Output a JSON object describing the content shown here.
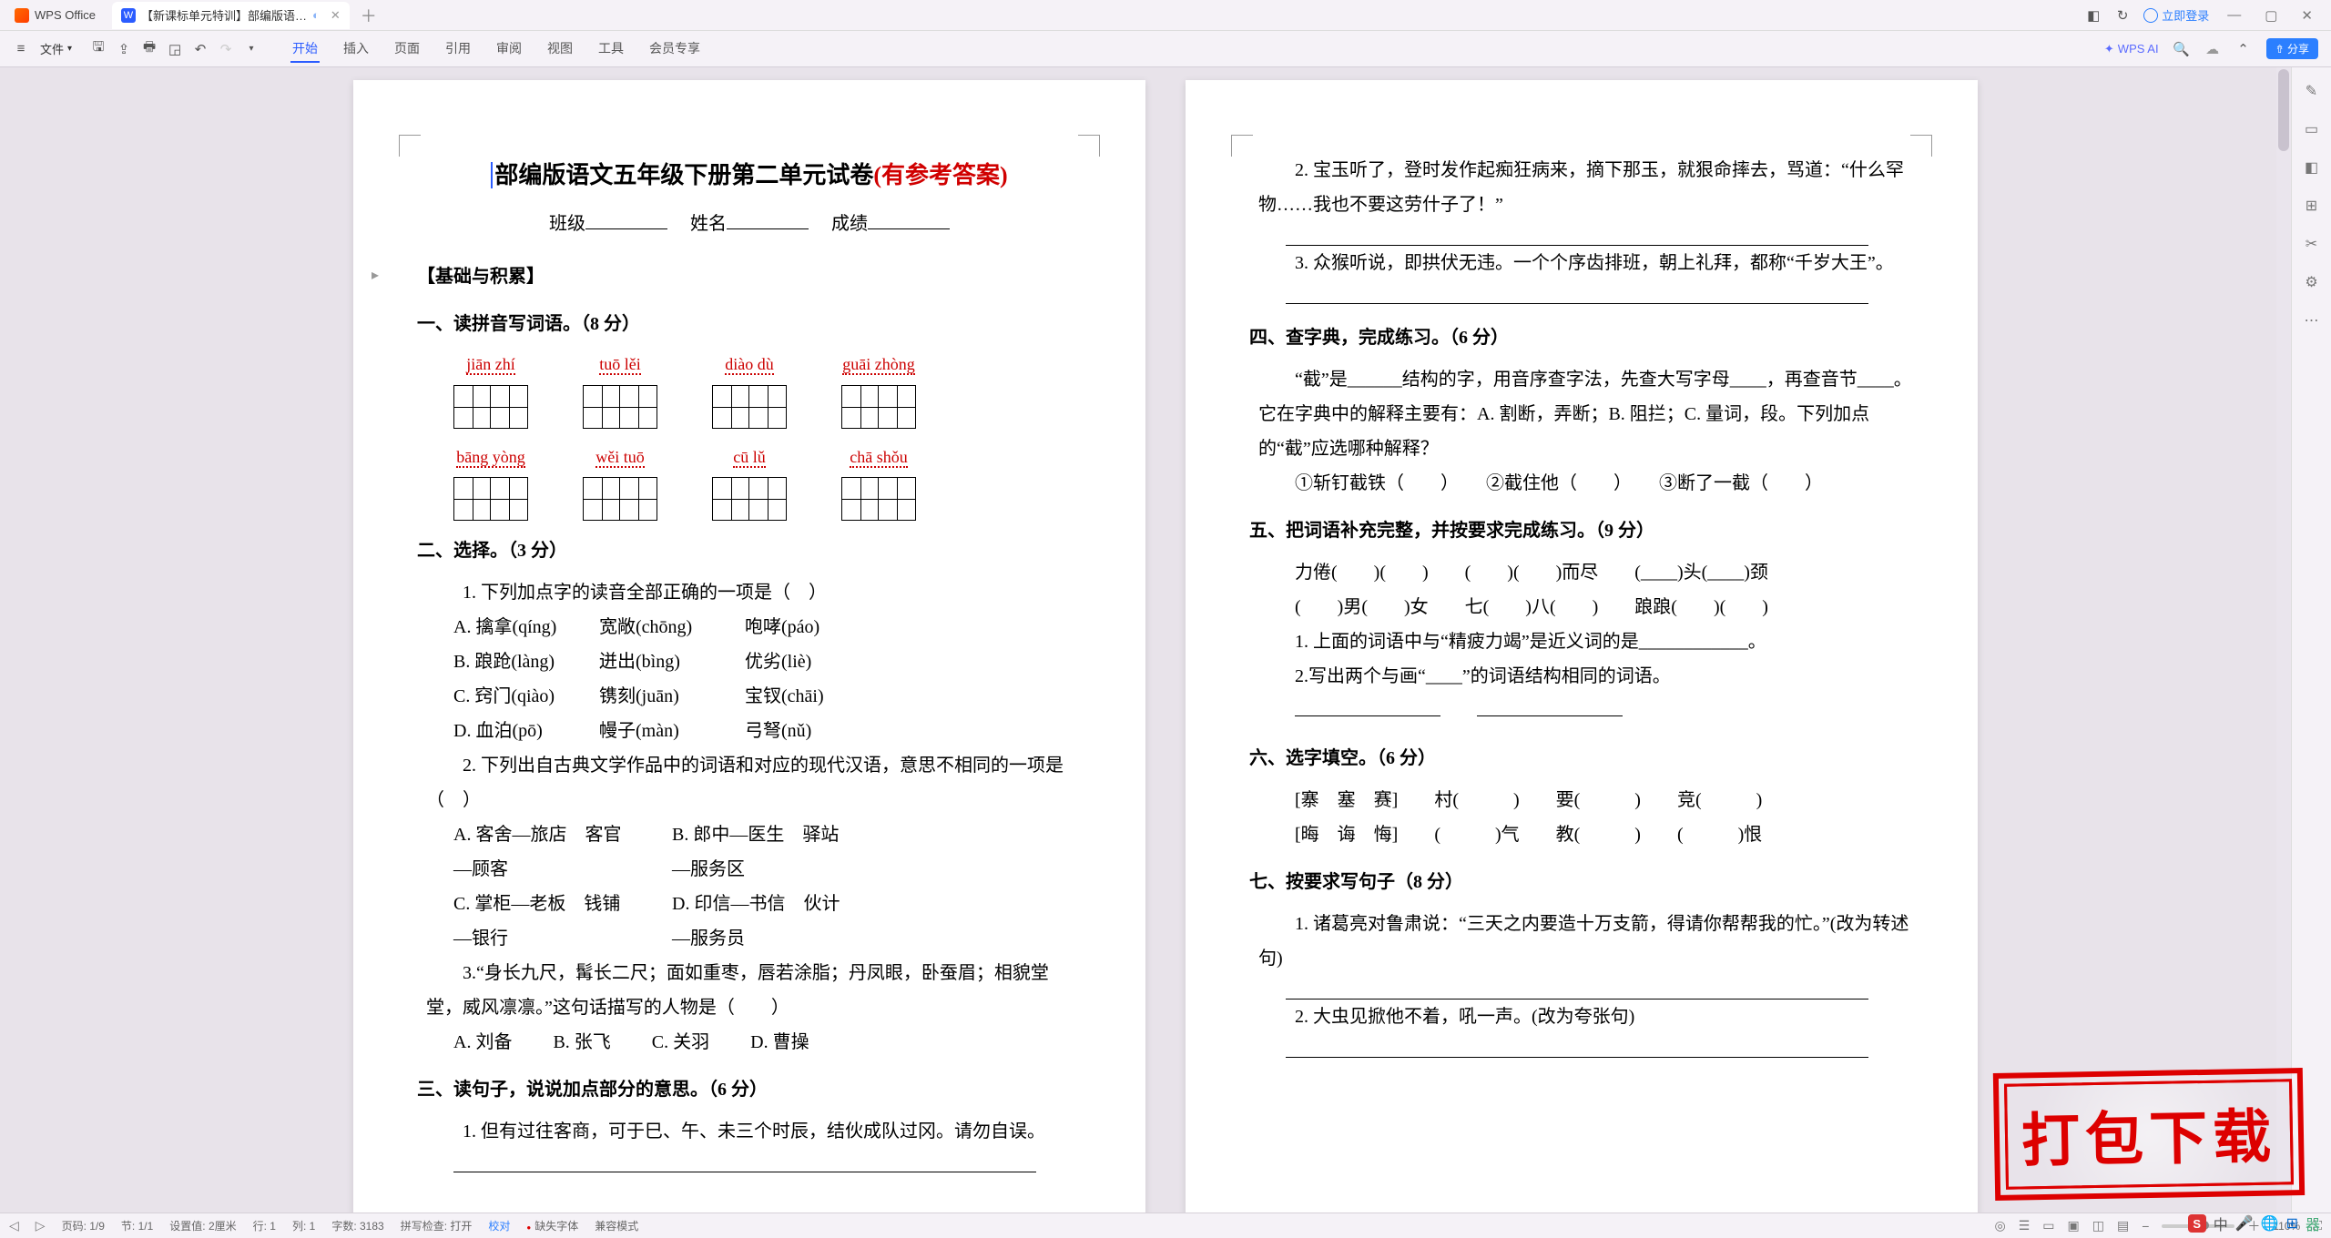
{
  "titlebar": {
    "app_name": "WPS Office",
    "doc_tab_label": "【新课标单元特训】部编版语…",
    "login_label": "立即登录"
  },
  "ribbon": {
    "file_menu": "文件",
    "tabs": [
      "开始",
      "插入",
      "页面",
      "引用",
      "审阅",
      "视图",
      "工具",
      "会员专享"
    ],
    "ai_label": "WPS AI",
    "share_label": "分享",
    "cloud_tip": "☁"
  },
  "page1": {
    "title_black": "部编版语文五年级下册第二单元试卷",
    "title_red": "(有参考答案)",
    "info_labels": [
      "班级",
      "姓名",
      "成绩"
    ],
    "section_basics": "【基础与积累】",
    "q1": "一、读拼音写词语。（8 分）",
    "pinyin_row1": [
      "jiān zhí",
      "tuō lěi",
      "diào dù",
      "guāi zhòng"
    ],
    "pinyin_row2": [
      "bāng yòng",
      "wěi tuō",
      "cū   lǔ",
      "chā shǒu"
    ],
    "q2": "二、选择。（3 分）",
    "q2_1": "1. 下列加点字的读音全部正确的一项是（　）",
    "q2_1_opts": [
      [
        "A. 擒拿(qíng)",
        "宽敞(chōng)",
        "咆哮(páo)"
      ],
      [
        "B. 踉跄(làng)",
        "迸出(bìng)",
        "优劣(liè)"
      ],
      [
        "C. 窍门(qiào)",
        "镌刻(juān)",
        "宝钗(chāi)"
      ],
      [
        "D. 血泊(pō)",
        "幔子(màn)",
        "弓弩(nǔ)"
      ]
    ],
    "q2_2": "2. 下列出自古典文学作品中的词语和对应的现代汉语，意思不相同的一项是（　）",
    "q2_2_opts": [
      [
        "A. 客舍—旅店　客官—顾客",
        "B. 郎中—医生　驿站—服务区"
      ],
      [
        "C. 掌柜—老板　钱铺—银行",
        "D. 印信—书信　伙计—服务员"
      ]
    ],
    "q2_3": "3.“身长九尺，髯长二尺；面如重枣，唇若涂脂；丹凤眼，卧蚕眉；相貌堂堂，威风凛凛。”这句话描写的人物是（　　）",
    "q2_3_opts": [
      "A. 刘备",
      "B. 张飞",
      "C. 关羽",
      "D. 曹操"
    ],
    "q3": "三、读句子，说说加点部分的意思。（6 分）",
    "q3_1": "1. 但有过往客商，可于巳、午、未三个时辰，结伙成队过冈。请勿自误。"
  },
  "page2": {
    "line1": "2. 宝玉听了，登时发作起痴狂病来，摘下那玉，就狠命摔去，骂道：“什么罕物……我也不要这劳什子了！”",
    "line2": "3. 众猴听说，即拱伏无违。一个个序齿排班，朝上礼拜，都称“千岁大王”。",
    "q4": "四、查字典，完成练习。（6 分）",
    "q4_text": "“截”是______结构的字，用音序查字法，先查大写字母____，再查音节____。它在字典中的解释主要有：A. 割断，弄断；B. 阻拦；C. 量词，段。下列加点的“截”应选哪种解释？",
    "q4_items": "①斩钉截铁（　　）　　②截住他（　　）　　③断了一截（　　）",
    "q5": "五、把词语补充完整，并按要求完成练习。（9 分）",
    "q5_line1": "力倦(　　)(　　)　　(　　)(　　)而尽　　(____)头(____)颈",
    "q5_line2": "(　　)男(　　)女　　七(　　)八(　　)　　踉踉(　　)(　　)",
    "q5_1": "1. 上面的词语中与“精疲力竭”是近义词的是____________。",
    "q5_2": "2.写出两个与画“____”的词语结构相同的词语。",
    "q6": "六、选字填空。（6 分）",
    "q6_line1": "[寨　塞　赛]　　村(　　　)　　要(　　　)　　竞(　　　)",
    "q6_line2": "[晦　诲　悔]　　(　　　)气　　教(　　　)　　(　　　)恨",
    "q7": "七、按要求写句子（8 分）",
    "q7_1": "1. 诸葛亮对鲁肃说：“三天之内要造十万支箭，得请你帮帮我的忙。”(改为转述句)",
    "q7_2": "2. 大虫见掀他不着，吼一声。(改为夸张句)"
  },
  "statusbar": {
    "items": [
      "页码: 1/9",
      "节: 1/1",
      "设置值: 2厘米",
      "行: 1",
      "列: 1",
      "字数: 3183",
      "拼写检查: 打开",
      "校对",
      "缺失字体",
      "兼容模式"
    ],
    "zoom": "110%"
  },
  "stamp": "打包下载"
}
